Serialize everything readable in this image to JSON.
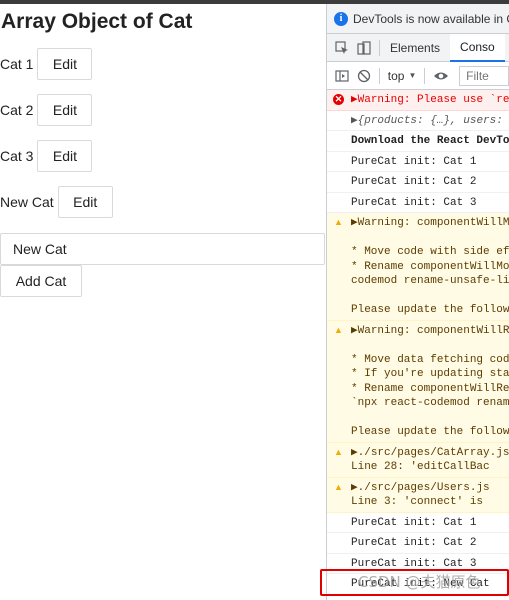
{
  "app": {
    "title": "Array Object of Cat",
    "cats": [
      {
        "name": "Cat 1",
        "edit_label": "Edit"
      },
      {
        "name": "Cat 2",
        "edit_label": "Edit"
      },
      {
        "name": "Cat 3",
        "edit_label": "Edit"
      },
      {
        "name": "New Cat",
        "edit_label": "Edit"
      }
    ],
    "new_cat_value": "New Cat",
    "add_label": "Add Cat"
  },
  "devtools": {
    "info_text": "DevTools is now available in C",
    "tabs": [
      "Elements",
      "Conso"
    ],
    "context": "top",
    "filter_placeholder": "Filte",
    "messages": [
      {
        "level": "error",
        "lines": [
          "▶Warning: Please use `re"
        ]
      },
      {
        "level": "obj",
        "lines": [
          "▶{products: {…}, users:"
        ]
      },
      {
        "level": "bold",
        "lines": [
          "Download the React DevTo"
        ]
      },
      {
        "level": "log",
        "lines": [
          "PureCat init: Cat 1"
        ]
      },
      {
        "level": "log",
        "lines": [
          "PureCat init: Cat 2"
        ]
      },
      {
        "level": "log",
        "lines": [
          "PureCat init: Cat 3"
        ]
      },
      {
        "level": "warn",
        "lines": [
          "▶Warning: componentWillM",
          "",
          "* Move code with side ef",
          "* Rename componentWillMo",
          "codemod rename-unsafe-li",
          "",
          "Please update the follow"
        ]
      },
      {
        "level": "warn",
        "lines": [
          "▶Warning: componentWillR",
          "",
          "* Move data fetching cod",
          "* If you're updating sta",
          "* Rename componentWillRe",
          "`npx react-codemod renam",
          "",
          "Please update the follow"
        ]
      },
      {
        "level": "warn",
        "lines": [
          "▶./src/pages/CatArray.js",
          "  Line 28:  'editCallBac"
        ]
      },
      {
        "level": "warn",
        "lines": [
          "▶./src/pages/Users.js",
          "  Line 3:  'connect' is"
        ]
      },
      {
        "level": "log",
        "lines": [
          "PureCat init: Cat 1"
        ]
      },
      {
        "level": "log",
        "lines": [
          "PureCat init: Cat 2"
        ]
      },
      {
        "level": "log",
        "lines": [
          "PureCat init: Cat 3"
        ]
      },
      {
        "level": "log",
        "lines": [
          "PureCat init: New Cat"
        ]
      }
    ],
    "watermark": "CSDN @夫猫原色"
  }
}
